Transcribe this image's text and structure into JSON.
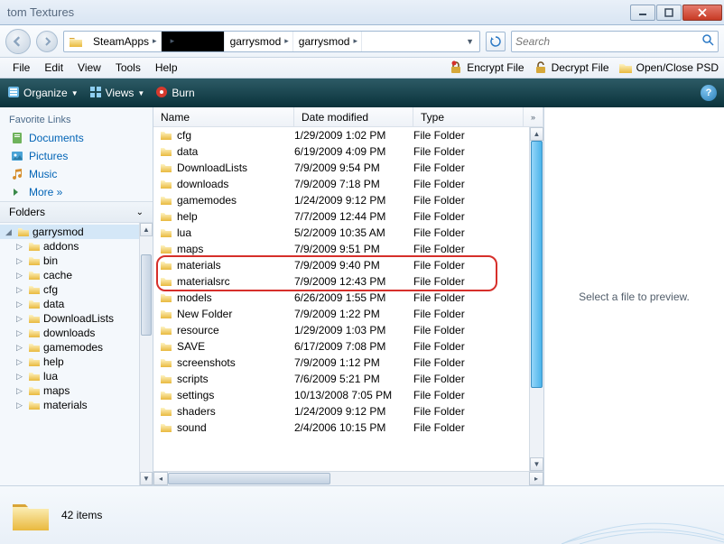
{
  "window": {
    "title_frag": "tom Textures"
  },
  "breadcrumbs": {
    "items": [
      "SteamApps",
      "",
      "garrysmod",
      "garrysmod"
    ],
    "blacked_index": 1
  },
  "search": {
    "placeholder": "Search"
  },
  "menu": {
    "items": [
      "File",
      "Edit",
      "View",
      "Tools",
      "Help"
    ],
    "ext": [
      {
        "icon": "lock",
        "label": "Encrypt File"
      },
      {
        "icon": "unlock",
        "label": "Decrypt File"
      },
      {
        "icon": "psd",
        "label": "Open/Close PSD"
      }
    ]
  },
  "cmd": {
    "organize": "Organize",
    "views": "Views",
    "burn": "Burn"
  },
  "fav": {
    "title": "Favorite Links",
    "links": [
      {
        "icon": "doc",
        "label": "Documents"
      },
      {
        "icon": "pic",
        "label": "Pictures"
      },
      {
        "icon": "music",
        "label": "Music"
      },
      {
        "icon": "more",
        "label": "More  »"
      }
    ],
    "folders_label": "Folders"
  },
  "tree": {
    "root": "garrysmod",
    "items": [
      "addons",
      "bin",
      "cache",
      "cfg",
      "data",
      "DownloadLists",
      "downloads",
      "gamemodes",
      "help",
      "lua",
      "maps",
      "materials"
    ]
  },
  "columns": {
    "name": "Name",
    "date": "Date modified",
    "type": "Type"
  },
  "files": [
    {
      "name": "cfg",
      "date": "1/29/2009 1:02 PM",
      "type": "File Folder"
    },
    {
      "name": "data",
      "date": "6/19/2009 4:09 PM",
      "type": "File Folder"
    },
    {
      "name": "DownloadLists",
      "date": "7/9/2009 9:54 PM",
      "type": "File Folder"
    },
    {
      "name": "downloads",
      "date": "7/9/2009 7:18 PM",
      "type": "File Folder"
    },
    {
      "name": "gamemodes",
      "date": "1/24/2009 9:12 PM",
      "type": "File Folder"
    },
    {
      "name": "help",
      "date": "7/7/2009 12:44 PM",
      "type": "File Folder"
    },
    {
      "name": "lua",
      "date": "5/2/2009 10:35 AM",
      "type": "File Folder"
    },
    {
      "name": "maps",
      "date": "7/9/2009 9:51 PM",
      "type": "File Folder"
    },
    {
      "name": "materials",
      "date": "7/9/2009 9:40 PM",
      "type": "File Folder"
    },
    {
      "name": "materialsrc",
      "date": "7/9/2009 12:43 PM",
      "type": "File Folder"
    },
    {
      "name": "models",
      "date": "6/26/2009 1:55 PM",
      "type": "File Folder"
    },
    {
      "name": "New Folder",
      "date": "7/9/2009 1:22 PM",
      "type": "File Folder"
    },
    {
      "name": "resource",
      "date": "1/29/2009 1:03 PM",
      "type": "File Folder"
    },
    {
      "name": "SAVE",
      "date": "6/17/2009 7:08 PM",
      "type": "File Folder"
    },
    {
      "name": "screenshots",
      "date": "7/9/2009 1:12 PM",
      "type": "File Folder"
    },
    {
      "name": "scripts",
      "date": "7/6/2009 5:21 PM",
      "type": "File Folder"
    },
    {
      "name": "settings",
      "date": "10/13/2008 7:05 PM",
      "type": "File Folder"
    },
    {
      "name": "shaders",
      "date": "1/24/2009 9:12 PM",
      "type": "File Folder"
    },
    {
      "name": "sound",
      "date": "2/4/2006 10:15 PM",
      "type": "File Folder"
    }
  ],
  "highlight": {
    "start_index": 8,
    "end_index": 9
  },
  "preview": {
    "empty": "Select a file to preview."
  },
  "status": {
    "count": "42 items"
  }
}
